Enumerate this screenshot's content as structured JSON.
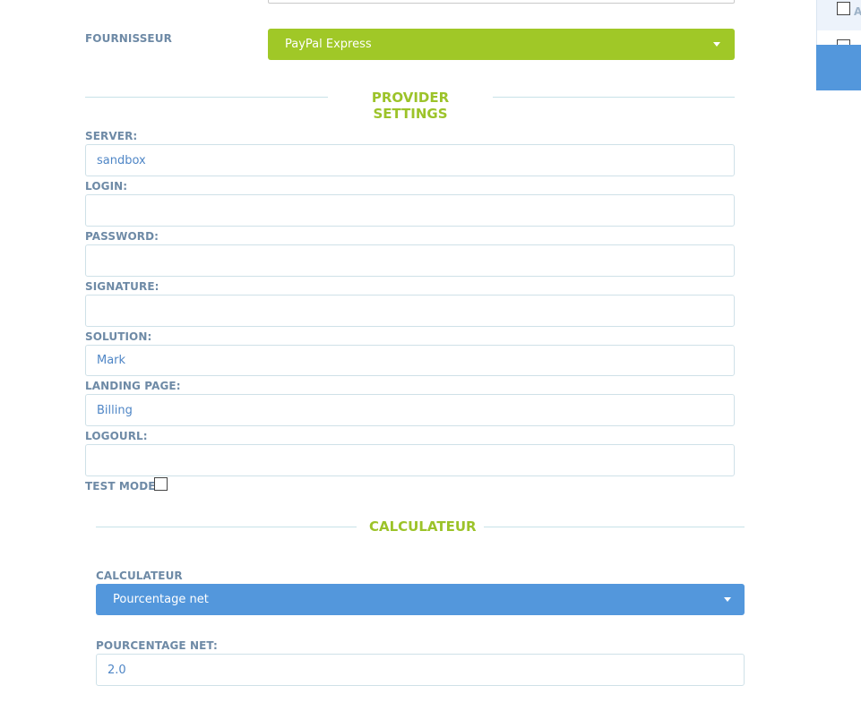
{
  "fournisseur": {
    "label": "FOURNISSEUR",
    "selected": "PayPal Express",
    "accent": "#a0c827"
  },
  "provider_settings": {
    "title": "PROVIDER SETTINGS",
    "fields": [
      {
        "label": "SERVER:",
        "value": "sandbox"
      },
      {
        "label": "LOGIN:",
        "value": ""
      },
      {
        "label": "PASSWORD:",
        "value": ""
      },
      {
        "label": "SIGNATURE:",
        "value": ""
      },
      {
        "label": "SOLUTION:",
        "value": "Mark"
      },
      {
        "label": "LANDING PAGE:",
        "value": "Billing"
      },
      {
        "label": "LOGOURL:",
        "value": ""
      }
    ],
    "test_mode": {
      "label": "TEST MODE:",
      "checked": false
    }
  },
  "calculateur": {
    "title": "CALCULATEUR",
    "select_label": "CALCULATEUR",
    "selected": "Pourcentage net",
    "accent": "#5397dc",
    "net_label": "POURCENTAGE NET:",
    "net_value": "2.0"
  },
  "right_panel": {
    "letter": "A"
  }
}
